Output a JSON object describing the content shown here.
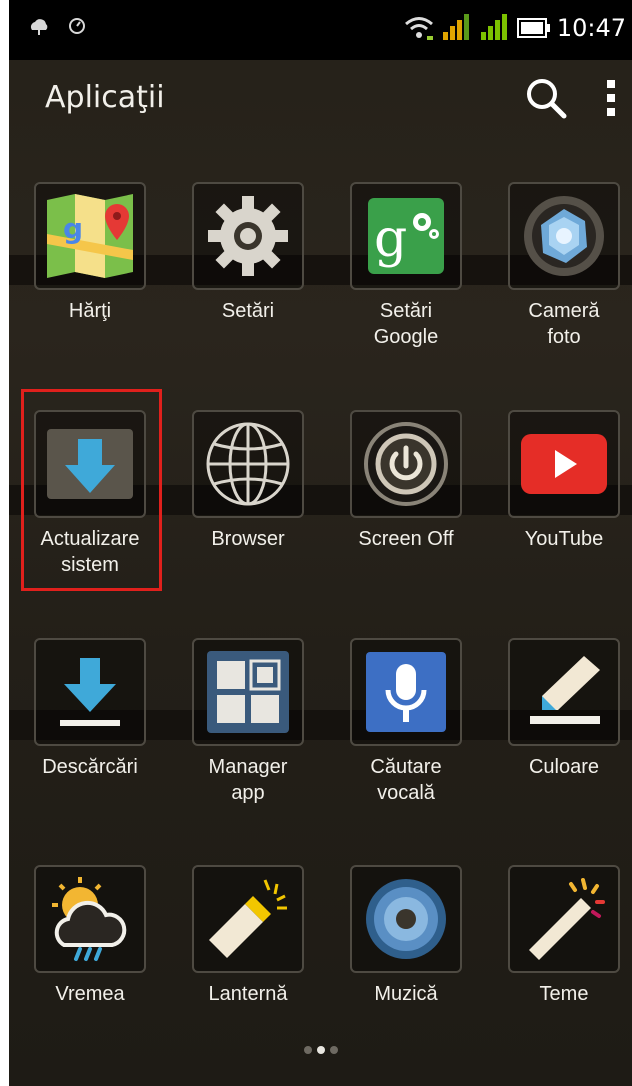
{
  "status_bar": {
    "time": "10:47"
  },
  "app_bar": {
    "title": "Aplicaţii"
  },
  "apps": [
    {
      "label_l1": "Hărţi",
      "label_l2": "",
      "icon": "maps-icon"
    },
    {
      "label_l1": "Setări",
      "label_l2": "",
      "icon": "gear-icon"
    },
    {
      "label_l1": "Setări",
      "label_l2": "Google",
      "icon": "google-settings-icon"
    },
    {
      "label_l1": "Cameră",
      "label_l2": "foto",
      "icon": "camera-icon"
    },
    {
      "label_l1": "Actualizare",
      "label_l2": "sistem",
      "icon": "system-update-icon"
    },
    {
      "label_l1": "Browser",
      "label_l2": "",
      "icon": "globe-icon"
    },
    {
      "label_l1": "Screen Off",
      "label_l2": "",
      "icon": "power-icon"
    },
    {
      "label_l1": "YouTube",
      "label_l2": "",
      "icon": "youtube-icon"
    },
    {
      "label_l1": "Descărcări",
      "label_l2": "",
      "icon": "download-icon"
    },
    {
      "label_l1": "Manager",
      "label_l2": "app",
      "icon": "app-manager-icon"
    },
    {
      "label_l1": "Căutare",
      "label_l2": "vocală",
      "icon": "microphone-icon"
    },
    {
      "label_l1": "Culoare",
      "label_l2": "",
      "icon": "brush-icon"
    },
    {
      "label_l1": "Vremea",
      "label_l2": "",
      "icon": "weather-icon"
    },
    {
      "label_l1": "Lanternă",
      "label_l2": "",
      "icon": "flashlight-icon"
    },
    {
      "label_l1": "Muzică",
      "label_l2": "",
      "icon": "speaker-icon"
    },
    {
      "label_l1": "Teme",
      "label_l2": "",
      "icon": "magic-wand-icon"
    }
  ],
  "pager": {
    "count": 3,
    "active": 1
  }
}
